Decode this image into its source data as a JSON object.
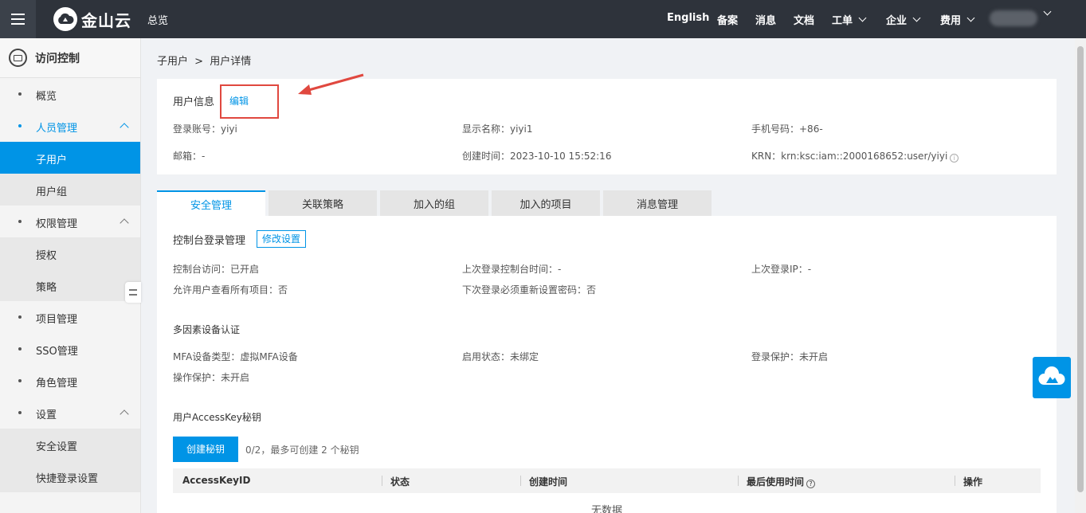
{
  "topbar": {
    "logo_text": "金山云",
    "overview": "总览",
    "nav": [
      "English",
      "备案",
      "消息",
      "文档",
      "工单",
      "企业",
      "费用"
    ]
  },
  "sidebar": {
    "title": "访问控制",
    "items": [
      {
        "label": "概览"
      },
      {
        "label": "人员管理"
      },
      {
        "label": "子用户"
      },
      {
        "label": "用户组"
      },
      {
        "label": "权限管理"
      },
      {
        "label": "授权"
      },
      {
        "label": "策略"
      },
      {
        "label": "项目管理"
      },
      {
        "label": "SSO管理"
      },
      {
        "label": "角色管理"
      },
      {
        "label": "设置"
      },
      {
        "label": "安全设置"
      },
      {
        "label": "快捷登录设置"
      }
    ]
  },
  "breadcrumb": {
    "parent": "子用户",
    "sep": ">",
    "current": "用户详情"
  },
  "user_info": {
    "title": "用户信息",
    "edit": "编辑",
    "login_account": "登录账号：yiyi",
    "display_name": "显示名称：yiyi1",
    "phone": "手机号码：+86-",
    "email": "邮箱：-",
    "created": "创建时间：2023-10-10 15:52:16",
    "krn": "KRN：krn:ksc:iam::2000168652:user/yiyi"
  },
  "tabs": [
    "安全管理",
    "关联策略",
    "加入的组",
    "加入的项目",
    "消息管理"
  ],
  "security": {
    "console_title": "控制台登录管理",
    "modify": "修改设置",
    "console_access": "控制台访问：已开启",
    "last_login_time": "上次登录控制台时间：-",
    "last_login_ip": "上次登录IP：-",
    "view_all_projects": "允许用户查看所有项目：否",
    "reset_password": "下次登录必须重新设置密码：否",
    "mfa_title": "多因素设备认证",
    "mfa_type": "MFA设备类型：虚拟MFA设备",
    "enable_status": "启用状态：未绑定",
    "login_protect": "登录保护：未开启",
    "op_protect": "操作保护：未开启",
    "ak_title": "用户AccessKey秘钥",
    "create_key": "创建秘钥",
    "key_quota": "0/2，最多可创建 2 个秘钥",
    "columns": [
      "AccessKeyID",
      "状态",
      "创建时间",
      "最后使用时间",
      "操作"
    ],
    "empty": "无数据"
  },
  "colors": {
    "accent": "#0094e6",
    "topbar": "#2e333b",
    "highlight": "#e0483f"
  }
}
